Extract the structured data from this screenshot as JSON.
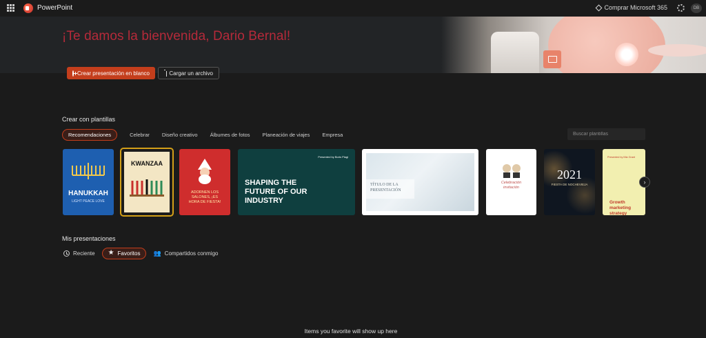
{
  "app": {
    "name": "PowerPoint"
  },
  "header": {
    "buy_label": "Comprar Microsoft 365",
    "avatar_initials": "DB"
  },
  "hero": {
    "welcome": "¡Te damos la bienvenida, Dario Bernal!",
    "new_blank_label": "Crear presentación en blanco",
    "upload_label": "Cargar un archivo"
  },
  "templates": {
    "title": "Crear con plantillas",
    "tabs": [
      {
        "label": "Recomendaciones",
        "active": true
      },
      {
        "label": "Celebrar"
      },
      {
        "label": "Diseño creativo"
      },
      {
        "label": "Álbumes de fotos"
      },
      {
        "label": "Planeación de viajes"
      },
      {
        "label": "Empresa"
      }
    ],
    "search_placeholder": "Buscar plantillas",
    "cards": {
      "hanukkah": {
        "title": "HANUKKAH",
        "sub": "LIGHT PEACE LOVE"
      },
      "kwanzaa": {
        "title": "KWANZAA"
      },
      "santa": {
        "title": "ADORNEN LOS SALONES, ¡ES HORA DE FIESTA!"
      },
      "industry": {
        "kicker": "Presented by Boris Plagi",
        "title": "SHAPING THE FUTURE OF OUR INDUSTRY"
      },
      "titulo": {
        "title": "TÍTULO DE LA PRESENTACIÓN"
      },
      "celebr": {
        "title": "Celebración invitación"
      },
      "year2021": {
        "year": "2021",
        "sub": "FIESTA DE NOCHEVIEJA"
      },
      "growth": {
        "kicker": "Presented by Mia Grant",
        "title": "Growth marketing strategy"
      }
    }
  },
  "my_presentations": {
    "title": "Mis presentaciones",
    "tabs": [
      {
        "label": "Reciente"
      },
      {
        "label": "Favoritos",
        "active": true
      },
      {
        "label": "Compartidos conmigo"
      }
    ],
    "empty_message": "Items you favorite will show up here"
  },
  "colors": {
    "accent": "#c43e1c",
    "welcome": "#b52a3a",
    "background": "#1b1b1b"
  }
}
